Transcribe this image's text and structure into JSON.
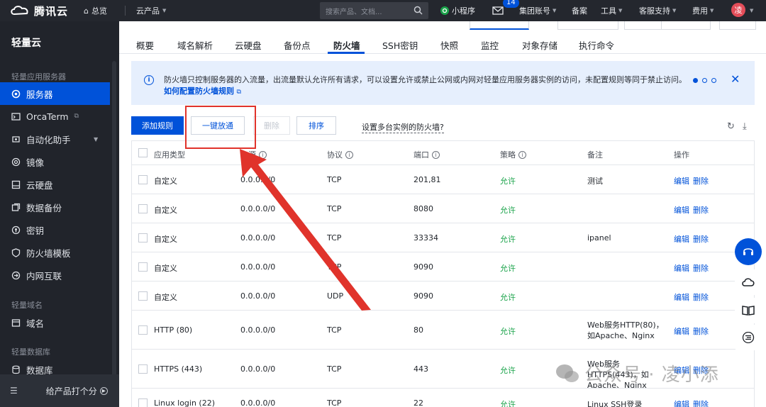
{
  "topbar": {
    "brand": "腾讯云",
    "overview": "总览",
    "products": "云产品",
    "search_placeholder": "搜索产品、文档...",
    "mini_program": "小程序",
    "mail_count": "14",
    "group_account": "集团账号",
    "beian": "备案",
    "tools": "工具",
    "support": "客服支持",
    "billing": "费用",
    "avatar_text": "凌"
  },
  "sidebar": {
    "title": "轻量云",
    "group_servers": "轻量应用服务器",
    "items": [
      {
        "label": "服务器",
        "icon": "server-icon",
        "active": true
      },
      {
        "label": "OrcaTerm",
        "icon": "terminal-icon"
      },
      {
        "label": "自动化助手",
        "icon": "automation-icon",
        "expandable": true
      },
      {
        "label": "镜像",
        "icon": "image-icon"
      },
      {
        "label": "云硬盘",
        "icon": "disk-icon"
      },
      {
        "label": "数据备份",
        "icon": "backup-icon"
      },
      {
        "label": "密钥",
        "icon": "key-icon"
      },
      {
        "label": "防火墙模板",
        "icon": "firewall-template-icon"
      },
      {
        "label": "内网互联",
        "icon": "network-icon"
      }
    ],
    "group_domain": "轻量域名",
    "domain_item": "域名",
    "group_db": "轻量数据库",
    "db_item": "数据库",
    "footer": "给产品打个分"
  },
  "tabs": [
    "概要",
    "域名解析",
    "云硬盘",
    "备份点",
    "防火墙",
    "SSH密钥",
    "快照",
    "监控",
    "对象存储",
    "执行命令"
  ],
  "active_tab": "防火墙",
  "notice": {
    "text": "防火墙只控制服务器的入流量，出流量默认允许所有请求，可以设置允许或禁止公网或内网对轻量应用服务器实例的访问，未配置规则等同于禁止访问。",
    "link": "如何配置防火墙规则"
  },
  "toolbar": {
    "add_rule": "添加规则",
    "one_click_open": "一键放通",
    "delete": "删除",
    "sort": "排序",
    "multi_instance": "设置多台实例的防火墙?"
  },
  "table": {
    "headers": {
      "app_type": "应用类型",
      "source": "来源",
      "protocol": "协议",
      "port": "端口",
      "policy": "策略",
      "remark": "备注",
      "action": "操作"
    },
    "edit_label": "编辑",
    "delete_label": "删除",
    "rows": [
      {
        "type": "自定义",
        "source": "0.0.0.0/0",
        "protocol": "TCP",
        "port": "201,81",
        "policy": "允许",
        "remark": "测试"
      },
      {
        "type": "自定义",
        "source": "0.0.0.0/0",
        "protocol": "TCP",
        "port": "8080",
        "policy": "允许",
        "remark": ""
      },
      {
        "type": "自定义",
        "source": "0.0.0.0/0",
        "protocol": "TCP",
        "port": "33334",
        "policy": "允许",
        "remark": "ipanel"
      },
      {
        "type": "自定义",
        "source": "0.0.0.0/0",
        "protocol": "TCP",
        "port": "9090",
        "policy": "允许",
        "remark": ""
      },
      {
        "type": "自定义",
        "source": "0.0.0.0/0",
        "protocol": "UDP",
        "port": "9090",
        "policy": "允许",
        "remark": ""
      },
      {
        "type": "HTTP (80)",
        "source": "0.0.0.0/0",
        "protocol": "TCP",
        "port": "80",
        "policy": "允许",
        "remark": "Web服务HTTP(80)，如Apache、Nginx"
      },
      {
        "type": "HTTPS (443)",
        "source": "0.0.0.0/0",
        "protocol": "TCP",
        "port": "443",
        "policy": "允许",
        "remark": "Web服务HTTPS(443)，如Apache、Nginx"
      },
      {
        "type": "Linux login (22)",
        "source": "0.0.0.0/0",
        "protocol": "TCP",
        "port": "22",
        "policy": "允许",
        "remark": "Linux SSH登录"
      }
    ]
  },
  "watermark": "公众号 · 凌小添",
  "colors": {
    "accent": "#0052d9",
    "allow": "#1aa34a",
    "highlight": "#e0332b",
    "topbar": "#24272e",
    "sidebar": "#21242b"
  }
}
